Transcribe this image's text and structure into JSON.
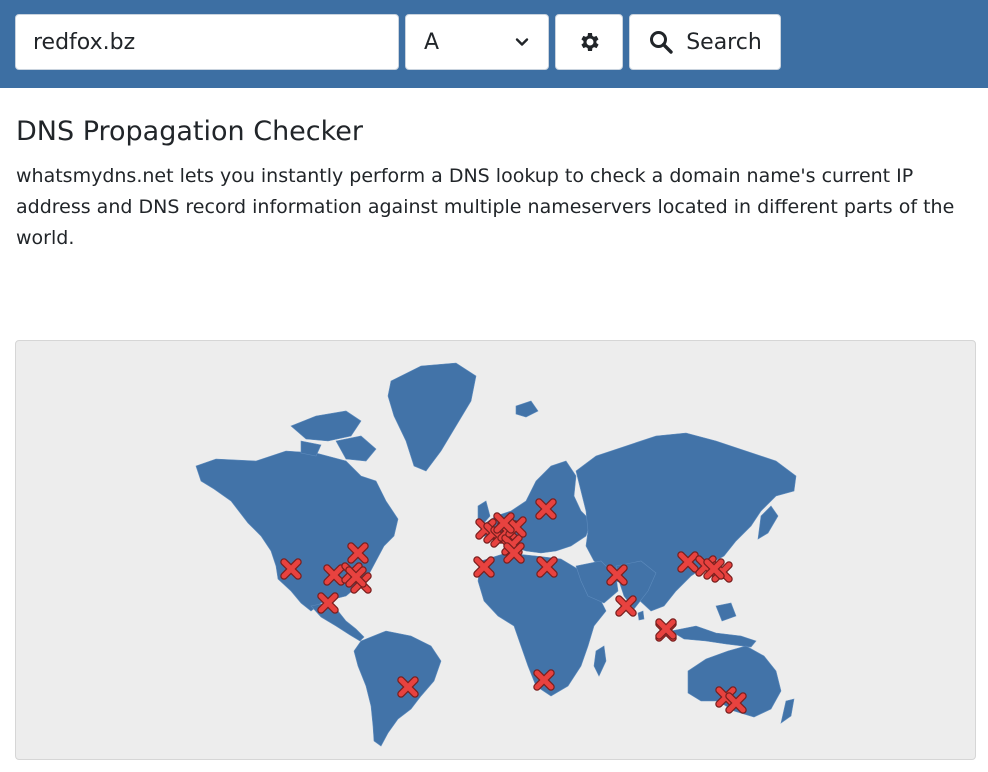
{
  "toolbar": {
    "domain_value": "redfox.bz",
    "record_type": "A",
    "search_label": "Search"
  },
  "content": {
    "title": "DNS Propagation Checker",
    "description": "whatsmydns.net lets you instantly perform a DNS lookup to check a domain name's current IP address and DNS record information against multiple nameservers located in different parts of the world."
  },
  "map": {
    "land_color": "#4273a8",
    "marker_color": "#e8423f",
    "marker_status": "failed",
    "marker_count": 30
  }
}
